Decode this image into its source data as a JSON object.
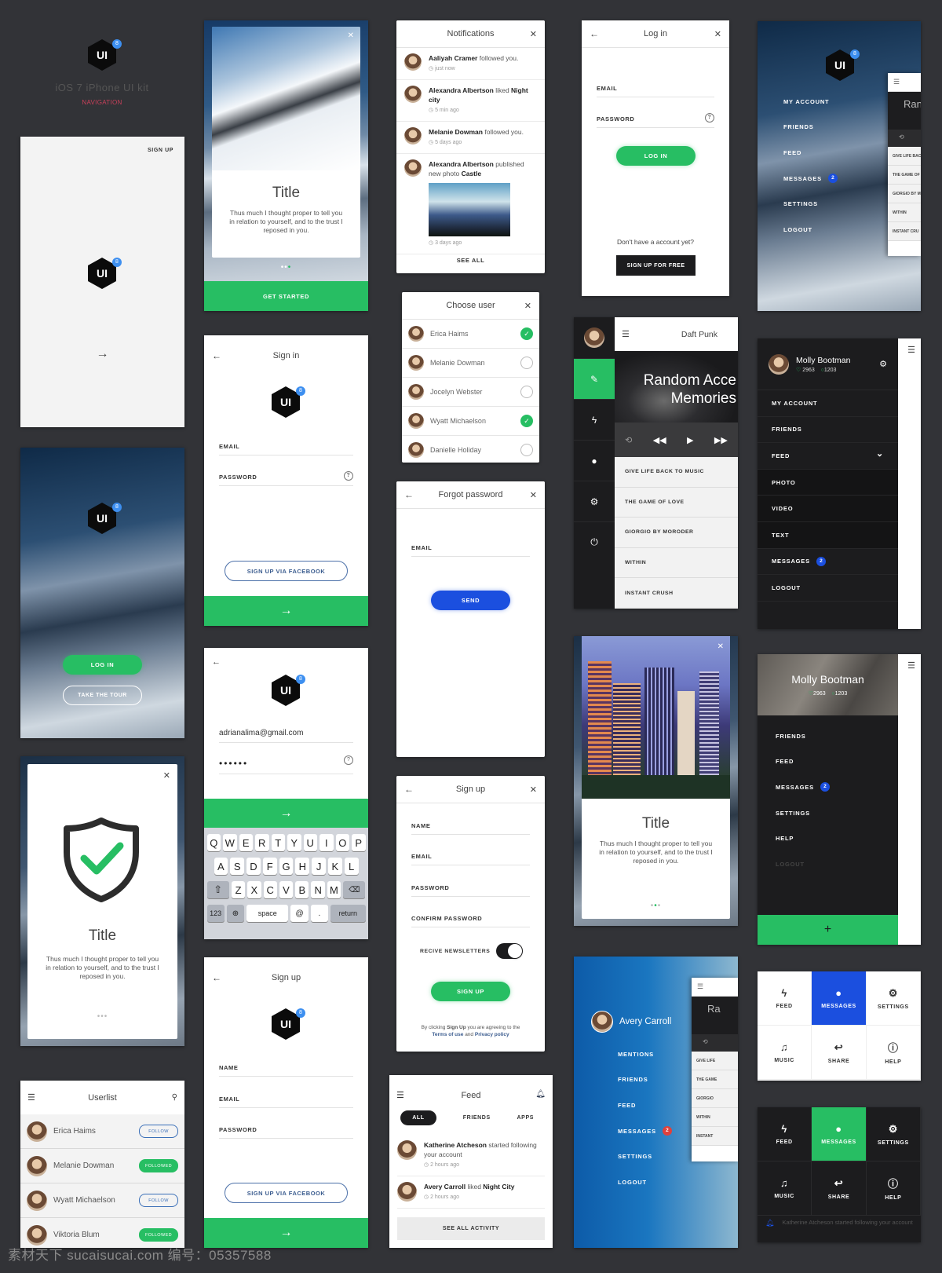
{
  "header": {
    "logo_text": "UI",
    "logo_badge": "8",
    "title": "iOS 7 iPhone UI kit",
    "subtitle": "NAVIGATION"
  },
  "colors": {
    "green": "#27be63",
    "blue": "#1b4fdf",
    "dark": "#1c1c1e",
    "background": "#323337",
    "red": "#e0413c"
  },
  "splash": {
    "sign_up": "SIGN UP"
  },
  "welcome": {
    "log_in": "LOG IN",
    "take_tour": "TAKE THE TOUR"
  },
  "onboarding": {
    "title": "Title",
    "body": "Thus much I thought proper to tell you in relation to yourself, and to the trust I reposed in you.",
    "cta": "GET STARTED"
  },
  "success": {
    "title": "Title",
    "body": "Thus much I thought proper to tell you in relation to yourself, and to the trust I reposed in you."
  },
  "city": {
    "title": "Title",
    "body": "Thus much I thought proper to tell you in relation to yourself, and to the trust I reposed in you."
  },
  "userlist": {
    "title": "Userlist",
    "users": [
      {
        "name": "Erica Haims",
        "action": "FOLLOW",
        "followed": false
      },
      {
        "name": "Melanie Dowman",
        "action": "FOLLOWED",
        "followed": true
      },
      {
        "name": "Wyatt Michaelson",
        "action": "FOLLOW",
        "followed": false
      },
      {
        "name": "Viktoria Blum",
        "action": "FOLLOWED",
        "followed": true
      }
    ]
  },
  "signin": {
    "title": "Sign in",
    "email": "EMAIL",
    "password": "PASSWORD",
    "facebook": "SIGN UP VIA FACEBOOK"
  },
  "keyboard_login": {
    "email_value": "adrianalima@gmail.com",
    "password_value": "••••••",
    "row1": [
      "Q",
      "W",
      "E",
      "R",
      "T",
      "Y",
      "U",
      "I",
      "O",
      "P"
    ],
    "row2": [
      "A",
      "S",
      "D",
      "F",
      "G",
      "H",
      "J",
      "K",
      "L"
    ],
    "row3": [
      "Z",
      "X",
      "C",
      "V",
      "B",
      "N",
      "M"
    ],
    "row4": [
      "123",
      "space",
      "@",
      ".",
      "return"
    ]
  },
  "signup_fb": {
    "title": "Sign up",
    "fields": [
      "NAME",
      "EMAIL",
      "PASSWORD"
    ],
    "facebook": "SIGN UP VIA FACEBOOK"
  },
  "notifications": {
    "title": "Notifications",
    "items": [
      {
        "name": "Aaliyah Cramer",
        "text": " followed you.",
        "object": "",
        "time": "just now"
      },
      {
        "name": "Alexandra Albertson",
        "text": " liked ",
        "object": "Night city",
        "time": "5 min ago"
      },
      {
        "name": "Melanie Dowman",
        "text": " followed you.",
        "object": "",
        "time": "5 days ago"
      },
      {
        "name": "Alexandra Albertson",
        "text": " published new photo ",
        "object": "Castle",
        "time": "3 days ago"
      }
    ],
    "see_all": "SEE ALL"
  },
  "choose_user": {
    "title": "Choose user",
    "users": [
      {
        "name": "Erica Haims",
        "selected": true
      },
      {
        "name": "Melanie Dowman",
        "selected": false
      },
      {
        "name": "Jocelyn Webster",
        "selected": false
      },
      {
        "name": "Wyatt Michaelson",
        "selected": true
      },
      {
        "name": "Danielle Holiday",
        "selected": false
      }
    ]
  },
  "forgot": {
    "title": "Forgot password",
    "email": "EMAIL",
    "send": "SEND"
  },
  "signup": {
    "title": "Sign up",
    "fields": [
      "NAME",
      "EMAIL",
      "PASSWORD",
      "CONFIRM PASSWORD"
    ],
    "newsletter": "RECIVE NEWSLETTERS",
    "newsletter_on": true,
    "submit": "SIGN UP",
    "legal_prefix": "By clicking ",
    "legal_bold": "Sign Up",
    "legal_mid": " you are agreeing to the",
    "terms": "Terms of use",
    "and": " and ",
    "privacy": "Privacy policy"
  },
  "feed": {
    "title": "Feed",
    "tabs": [
      "ALL",
      "FRIENDS",
      "APPS"
    ],
    "active_tab": "ALL",
    "items": [
      {
        "name": "Katherine Atcheson",
        "text": " started following your account",
        "object": "",
        "time": "2 hours ago"
      },
      {
        "name": "Avery Carroll",
        "text": " liked ",
        "object": "Night City",
        "time": "2 hours ago"
      }
    ],
    "see_all": "SEE ALL ACTIVITY"
  },
  "login": {
    "title": "Log in",
    "email": "EMAIL",
    "password": "PASSWORD",
    "submit": "LOG IN",
    "no_account": "Don't have a account yet?",
    "signup": "SIGN UP FOR FREE"
  },
  "music": {
    "artist": "Daft Punk",
    "album_line1": "Random Acce",
    "album_line2": "Memories",
    "tracks": [
      "GIVE LIFE BACK TO MUSIC",
      "THE GAME OF LOVE",
      "GIORGIO BY MORODER",
      "WITHIN",
      "INSTANT CRUSH"
    ]
  },
  "mountain_menu": {
    "items": [
      {
        "label": "MY ACCOUNT"
      },
      {
        "label": "FRIENDS"
      },
      {
        "label": "FEED"
      },
      {
        "label": "MESSAGES",
        "badge": "2"
      },
      {
        "label": "SETTINGS"
      },
      {
        "label": "LOGOUT"
      }
    ],
    "peek_title": "Ran",
    "peek_tracks": [
      "GIVE LIFE BAC",
      "THE GAME OF",
      "GIORGIO BY M",
      "WITHIN",
      "INSTANT CRU"
    ]
  },
  "molly_menu": {
    "name": "Molly Bootman",
    "likes": "2963",
    "comments": "1203",
    "items": [
      {
        "label": "MY ACCOUNT"
      },
      {
        "label": "FRIENDS"
      },
      {
        "label": "FEED",
        "expanded": true
      },
      {
        "label": "PHOTO",
        "sub": true
      },
      {
        "label": "VIDEO",
        "sub": true
      },
      {
        "label": "TEXT",
        "sub": true
      },
      {
        "label": "MESSAGES",
        "badge": "2"
      },
      {
        "label": "LOGOUT"
      }
    ]
  },
  "molly_profile": {
    "name": "Molly Bootman",
    "likes": "2963",
    "comments": "1203",
    "items": [
      {
        "label": "FRIENDS"
      },
      {
        "label": "FEED"
      },
      {
        "label": "MESSAGES",
        "badge": "2"
      },
      {
        "label": "SETTINGS"
      },
      {
        "label": "HELP"
      },
      {
        "label": "LOGOUT",
        "disabled": true
      }
    ]
  },
  "avery_menu": {
    "name": "Avery Carroll",
    "items": [
      {
        "label": "MENTIONS"
      },
      {
        "label": "FRIENDS"
      },
      {
        "label": "FEED"
      },
      {
        "label": "MESSAGES",
        "badge": "2"
      },
      {
        "label": "SETTINGS"
      },
      {
        "label": "LOGOUT"
      }
    ],
    "peek_title": "Ra",
    "peek_tracks": [
      "GIVE LIFE",
      "THE GAME",
      "GIORGIO",
      "WITHIN",
      "INSTANT"
    ]
  },
  "grid_light": {
    "items": [
      {
        "label": "FEED",
        "icon": "lightning-icon"
      },
      {
        "label": "MESSAGES",
        "icon": "chat-icon",
        "active": true
      },
      {
        "label": "SETTINGS",
        "icon": "gear-icon"
      },
      {
        "label": "MUSIC",
        "icon": "music-icon"
      },
      {
        "label": "SHARE",
        "icon": "share-icon"
      },
      {
        "label": "HELP",
        "icon": "help-icon"
      }
    ]
  },
  "grid_dark": {
    "items": [
      {
        "label": "FEED",
        "icon": "lightning-icon"
      },
      {
        "label": "MESSAGES",
        "icon": "chat-icon",
        "active": true
      },
      {
        "label": "SETTINGS",
        "icon": "gear-icon"
      },
      {
        "label": "MUSIC",
        "icon": "music-icon"
      },
      {
        "label": "SHARE",
        "icon": "share-icon"
      },
      {
        "label": "HELP",
        "icon": "help-icon"
      }
    ],
    "toast_name": "Katherine Atcheson",
    "toast_text": " started following your account"
  },
  "watermark": "素材天下 sucaisucai.com  编号：05357588"
}
